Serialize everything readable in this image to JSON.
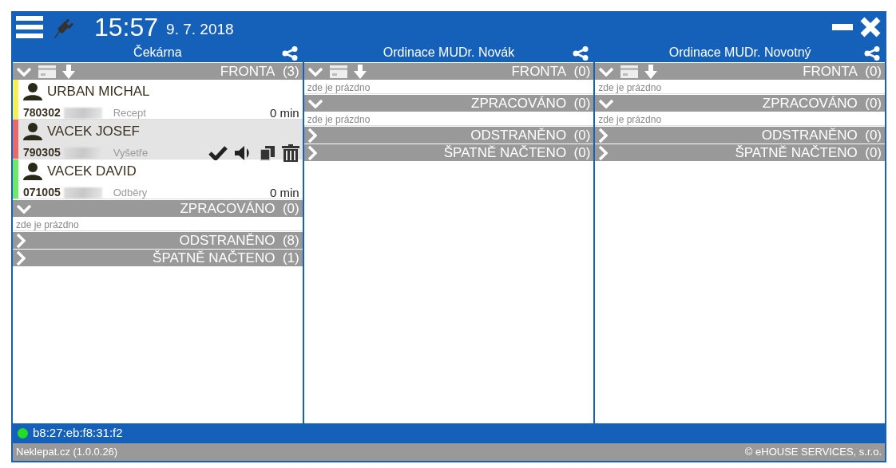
{
  "header": {
    "time": "15:57",
    "date": "9. 7. 2018",
    "plugged": false
  },
  "columns": [
    {
      "title": "Čekárna",
      "sections": [
        {
          "label": "FRONTA",
          "count": "(3)",
          "expanded": true,
          "toolbar": true,
          "patients": [
            {
              "name": "URBAN MICHAL",
              "id": "780302",
              "service": "Recept",
              "wait": "0 min",
              "color": "#f5f05a",
              "selected": false
            },
            {
              "name": "VACEK JOSEF",
              "id": "790305",
              "service": "Vyšetře",
              "color": "#e86a6a",
              "selected": true
            },
            {
              "name": "VACEK DAVID",
              "id": "071005",
              "service": "Odběry",
              "wait": "0 min",
              "color": "#6ee86a",
              "selected": false
            }
          ]
        },
        {
          "label": "ZPRACOVÁNO",
          "count": "(0)",
          "expanded": true,
          "empty_text": "zde je prázdno"
        },
        {
          "label": "ODSTRANĚNO",
          "count": "(8)",
          "expanded": false
        },
        {
          "label": "ŠPATNĚ NAČTENO",
          "count": "(1)",
          "expanded": false
        }
      ]
    },
    {
      "title": "Ordinace MUDr. Novák",
      "sections": [
        {
          "label": "FRONTA",
          "count": "(0)",
          "expanded": true,
          "toolbar": true,
          "empty_text": "zde je prázdno"
        },
        {
          "label": "ZPRACOVÁNO",
          "count": "(0)",
          "expanded": true,
          "empty_text": "zde je prázdno"
        },
        {
          "label": "ODSTRANĚNO",
          "count": "(0)",
          "expanded": false
        },
        {
          "label": "ŠPATNĚ NAČTENO",
          "count": "(0)",
          "expanded": false
        }
      ]
    },
    {
      "title": "Ordinace MUDr. Novotný",
      "sections": [
        {
          "label": "FRONTA",
          "count": "(0)",
          "expanded": true,
          "toolbar": true,
          "empty_text": "zde je prázdno"
        },
        {
          "label": "ZPRACOVÁNO",
          "count": "(0)",
          "expanded": true,
          "empty_text": "zde je prázdno"
        },
        {
          "label": "ODSTRANĚNO",
          "count": "(0)",
          "expanded": false
        },
        {
          "label": "ŠPATNĚ NAČTENO",
          "count": "(0)",
          "expanded": false
        }
      ]
    }
  ],
  "status_bar": {
    "device": "b8:27:eb:f8:31:f2",
    "online": true
  },
  "footer": {
    "app": "Neklepat.cz (1.0.0.26)",
    "copyright": "© eHOUSE SERVICES, s.r.o."
  }
}
